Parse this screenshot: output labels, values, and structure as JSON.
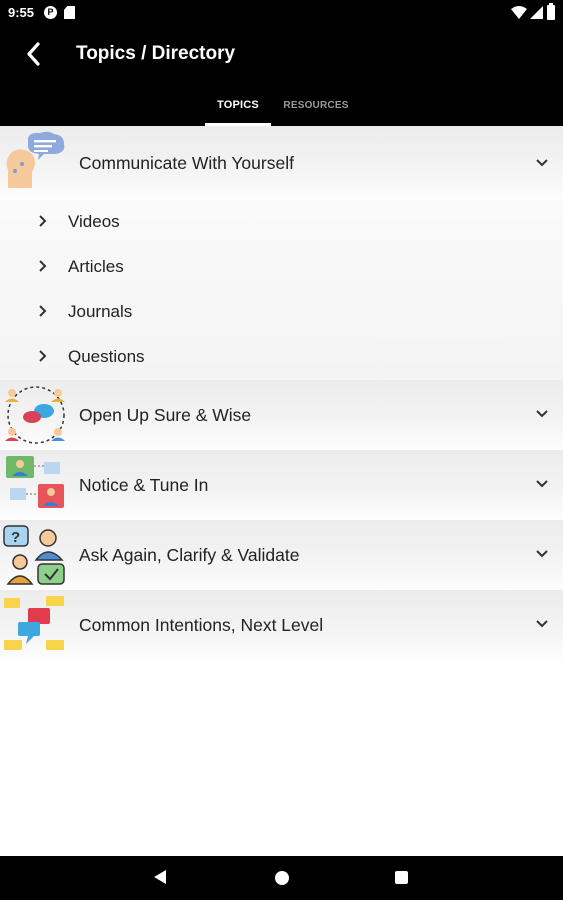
{
  "status_bar": {
    "time": "9:55",
    "icons": [
      "pocket-casts-icon",
      "sd-card-icon",
      "wifi-icon",
      "signal-icon",
      "battery-icon"
    ]
  },
  "app_bar": {
    "title": "Topics / Directory",
    "back_icon": "back-arrow-icon"
  },
  "tabs": [
    {
      "label": "TOPICS",
      "selected": true
    },
    {
      "label": "RESOURCES",
      "selected": false
    }
  ],
  "topics": [
    {
      "label": "Communicate With Yourself",
      "icon": "thinking-head-icon",
      "expanded": true,
      "subitems": [
        {
          "label": "Videos"
        },
        {
          "label": "Articles"
        },
        {
          "label": "Journals"
        },
        {
          "label": "Questions"
        }
      ]
    },
    {
      "label": "Open Up Sure & Wise",
      "icon": "group-chat-icon",
      "expanded": false
    },
    {
      "label": "Notice & Tune In",
      "icon": "conversation-icon",
      "expanded": false
    },
    {
      "label": "Ask Again, Clarify & Validate",
      "icon": "question-check-icon",
      "expanded": false
    },
    {
      "label": "Common Intentions, Next Level",
      "icon": "speech-bubbles-icon",
      "expanded": false
    }
  ],
  "nav_bar": {
    "icons": [
      "nav-back-icon",
      "nav-home-icon",
      "nav-recents-icon"
    ]
  },
  "colors": {
    "bar_background": "#000000",
    "row_background": "#ececec",
    "text": "#222222",
    "tab_inactive": "#9a9a9a"
  }
}
